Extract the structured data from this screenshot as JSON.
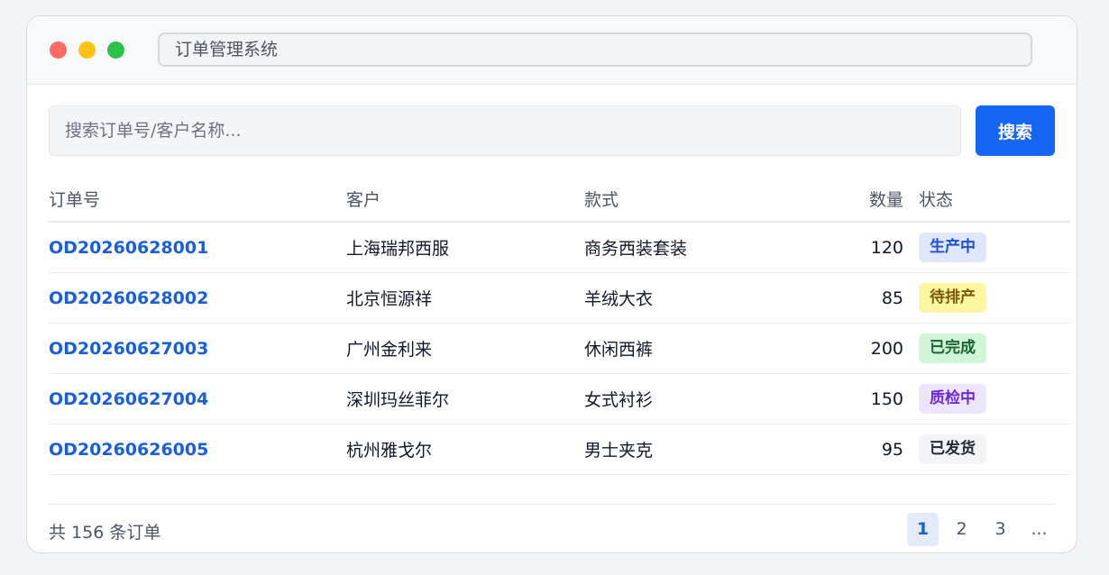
{
  "window": {
    "title": "订单管理系统"
  },
  "search": {
    "placeholder": "搜索订单号/客户名称...",
    "button_label": "搜索"
  },
  "table": {
    "headers": {
      "order": "订单号",
      "customer": "客户",
      "style": "款式",
      "quantity": "数量",
      "status": "状态"
    },
    "rows": [
      {
        "order": "OD20260628001",
        "customer": "上海瑞邦西服",
        "style": "商务西装套装",
        "quantity": "120",
        "status": "生产中",
        "status_bg": "#dfe8fb",
        "status_fg": "#1d4ed8"
      },
      {
        "order": "OD20260628002",
        "customer": "北京恒源祥",
        "style": "羊绒大衣",
        "quantity": "85",
        "status": "待排产",
        "status_bg": "#fdf6a3",
        "status_fg": "#7c5a06"
      },
      {
        "order": "OD20260627003",
        "customer": "广州金利来",
        "style": "休闲西裤",
        "quantity": "200",
        "status": "已完成",
        "status_bg": "#d1f5d8",
        "status_fg": "#166534"
      },
      {
        "order": "OD20260627004",
        "customer": "深圳玛丝菲尔",
        "style": "女式衬衫",
        "quantity": "150",
        "status": "质检中",
        "status_bg": "#ede5fb",
        "status_fg": "#6d28d9"
      },
      {
        "order": "OD20260626005",
        "customer": "杭州雅戈尔",
        "style": "男士夹克",
        "quantity": "95",
        "status": "已发货",
        "status_bg": "#f2f4f7",
        "status_fg": "#1f2937"
      }
    ]
  },
  "footer": {
    "total_text": "共 156 条订单",
    "pages": [
      "1",
      "2",
      "3",
      "..."
    ],
    "active_page": "1"
  },
  "colors": {
    "accent": "#1665f3",
    "link": "#1a5fd8"
  }
}
